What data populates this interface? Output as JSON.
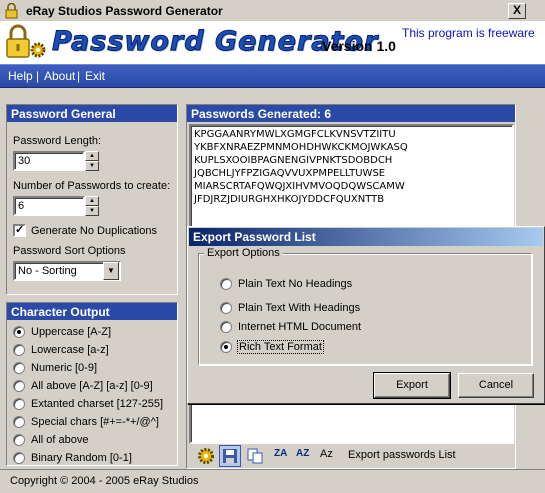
{
  "window": {
    "title": "eRay Studios Password Generator",
    "close_glyph": "X"
  },
  "header": {
    "app_title": "Password Generator",
    "version": "Version 1.0",
    "freeware": "This program is freeware"
  },
  "menu": {
    "items": [
      "Help",
      "About",
      "Exit"
    ],
    "separator": "|"
  },
  "password_general": {
    "heading": "Password General",
    "length_label": "Password Length:",
    "length_value": "30",
    "count_label": "Number of Passwords to create:",
    "count_value": "6",
    "no_dup_label": "Generate No Duplications",
    "no_dup_checked": true,
    "sort_label": "Password Sort Options",
    "sort_value": "No - Sorting"
  },
  "character_output": {
    "heading": "Character Output",
    "selected_index": 0,
    "options": [
      "Uppercase [A-Z]",
      "Lowercase [a-z]",
      "Numeric [0-9]",
      "All above [A-Z] [a-z] [0-9]",
      "Extanted charset [127-255]",
      "Special chars [#+=-*+/@^]",
      "All of above",
      "Binary Random [0-1]"
    ]
  },
  "passwords": {
    "heading": "Passwords Generated: 6",
    "lines": [
      "KPGGAANRYMWLXGMGFCLKVNSVTZIITU",
      "YKBFXNRAEZPMNMOHDHWKCKMOJWKASQ",
      "KUPLSXOOIBPAGNENGIVPNKTSDOBDCH",
      "JQBCHLJYFPZIGAQVVUXPMPELLTUWSE",
      "MIARSCRTAFQWQJXIHVMVOQDQWSCAMW",
      "JFDJRZJDIURGHXHKOJYDDCFQUXNTTB"
    ]
  },
  "toolbar": {
    "icons": [
      "gear-icon",
      "save-icon",
      "copy-icon",
      "sort-za-icon",
      "sort-az-icon",
      "case-icon"
    ],
    "sort_za_glyph": "ZA",
    "sort_az_glyph": "AZ",
    "case_glyph": "Az",
    "export_label": "Export passwords List"
  },
  "status": {
    "text": "Copyright © 2004 - 2005 eRay Studios"
  },
  "export_dialog": {
    "title": "Export Password List",
    "group_label": "Export Options",
    "selected_index": 3,
    "options": [
      "Plain Text No Headings",
      "Plain Text With Headings",
      "Internet HTML Document",
      "Rich Text Format"
    ],
    "export_button": "Export",
    "cancel_button": "Cancel"
  },
  "colors": {
    "panel_header": "#2b4aa8",
    "title_blue": "#1a4fb7",
    "freeware_text": "#1010c8",
    "dialog_title": "#0a246a"
  }
}
